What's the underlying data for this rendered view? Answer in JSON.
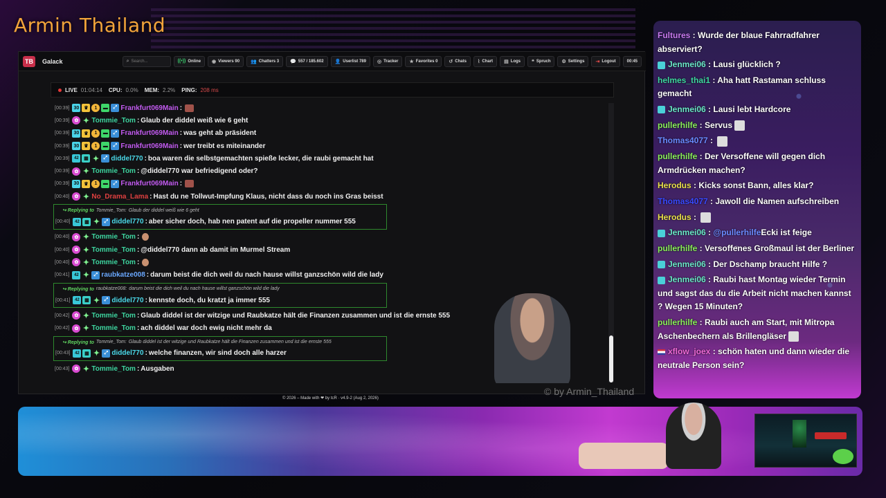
{
  "overlay": {
    "stream_title": "Armin Thailand",
    "watermark": "© by Armin_Thailand"
  },
  "app": {
    "name": "Galack",
    "logo_text": "TB",
    "toolbar": {
      "search_placeholder": "Search...",
      "online": "Online",
      "viewers": "Viewers 90",
      "chatters": "Chatters 3",
      "messages": "557 / 185.602",
      "userlist": "Userlist 789",
      "tracker": "Tracker",
      "favorites": "Favorites 0",
      "chats": "Chats",
      "chart": "Chart",
      "logs": "Logs",
      "spruch": "Spruch",
      "settings": "Settings",
      "logout": "Logout",
      "time": "00:45"
    },
    "status": {
      "live_label": "LIVE",
      "live_time": "01:04:14",
      "cpu_label": "CPU:",
      "cpu_value": "0.0%",
      "mem_label": "MEM:",
      "mem_value": "2.2%",
      "ping_label": "PING:",
      "ping_value": "208 ms"
    },
    "footer": "© 2026 – Made with ❤ by tcR · v4.9-2 (Aug 2, 2026)"
  },
  "colors": {
    "frankfurt": "#c25af0",
    "tommie": "#3ed6a0",
    "diddel": "#4ad8e8",
    "nodrama": "#e04040",
    "raubkatze": "#6aa8ff",
    "stream_title": "#f2a43a"
  },
  "chat": {
    "messages": [
      {
        "ts": "[00:39]",
        "user": "Frankfurt069Main",
        "color": "#c25af0",
        "text": "",
        "badges": [
          "sub",
          "crown",
          "gold",
          "green",
          "axe"
        ],
        "emote": true
      },
      {
        "ts": "[00:39]",
        "user": "Tommie_Tom",
        "color": "#3ed6a0",
        "text": "Glaub der diddel weiß wie 6 geht",
        "badges": [
          "pink",
          "spark"
        ]
      },
      {
        "ts": "[00:39]",
        "user": "Frankfurt069Main",
        "color": "#c25af0",
        "text": "was geht ab präsident",
        "badges": [
          "sub",
          "crown",
          "gold",
          "green",
          "axe"
        ]
      },
      {
        "ts": "[00:39]",
        "user": "Frankfurt069Main",
        "color": "#c25af0",
        "text": "wer treibt es miteinander",
        "badges": [
          "sub",
          "crown",
          "gold",
          "green",
          "axe"
        ]
      },
      {
        "ts": "[00:39]",
        "user": "diddel770",
        "color": "#4ad8e8",
        "text": "boa waren die selbstgemachten spieße lecker, die raubi gemacht hat",
        "badges": [
          "num",
          "grid",
          "spark",
          "axe"
        ]
      },
      {
        "ts": "[00:39]",
        "user": "Tommie_Tom",
        "color": "#3ed6a0",
        "text": "@diddel770 war befriedigend oder?",
        "badges": [
          "pink",
          "spark"
        ]
      },
      {
        "ts": "[00:39]",
        "user": "Frankfurt069Main",
        "color": "#c25af0",
        "text": "",
        "badges": [
          "sub",
          "crown",
          "gold",
          "green",
          "axe"
        ],
        "emote": true
      },
      {
        "ts": "[00:40]",
        "user": "No_Drama_Lama",
        "color": "#e04040",
        "text": "Hast du ne Tollwut-Impfung Klaus, nicht dass du noch ins Gras beisst",
        "badges": [
          "pink",
          "spark"
        ]
      }
    ],
    "reply1": {
      "replying_to": "Replying to",
      "target": "Tommie_Tom:",
      "quote": "Glaub der diddel weiß wie 6 geht",
      "ts": "[00:40]",
      "user": "diddel770",
      "text": "aber sicher doch, hab nen patent auf die propeller nummer 555"
    },
    "messages2": [
      {
        "ts": "[00:40]",
        "user": "Tommie_Tom",
        "color": "#3ed6a0",
        "text": "",
        "emote": "face"
      },
      {
        "ts": "[00:40]",
        "user": "Tommie_Tom",
        "color": "#3ed6a0",
        "text": "@diddel770 dann ab damit im Murmel Stream"
      },
      {
        "ts": "[00:40]",
        "user": "Tommie_Tom",
        "color": "#3ed6a0",
        "text": "",
        "emote": "face"
      },
      {
        "ts": "[00:41]",
        "user": "raubkatze008",
        "color": "#6aa8ff",
        "text": "darum beist die dich weil du nach hause willst ganzschön wild die lady"
      }
    ],
    "reply2": {
      "replying_to": "Replying to",
      "target": "raubkatze008:",
      "quote": "darum beist die dich weil du nach hause willst ganzschön wild die lady",
      "ts": "[00:41]",
      "user": "diddel770",
      "text": "kennste doch, du kratzt ja immer 555"
    },
    "messages3": [
      {
        "ts": "[00:42]",
        "user": "Tommie_Tom",
        "color": "#3ed6a0",
        "text": "Glaub diddel ist der witzige und Raubkatze hält die Finanzen zusammen und ist die ernste 555"
      },
      {
        "ts": "[00:42]",
        "user": "Tommie_Tom",
        "color": "#3ed6a0",
        "text": "ach diddel war doch ewig nicht mehr da"
      }
    ],
    "reply3": {
      "replying_to": "Replying to",
      "target": "Tommie_Tom:",
      "quote": "Glaub diddel ist der witzige und Raubkatze hält die Finanzen zusammen und ist die ernste 555",
      "ts": "[00:43]",
      "user": "diddel770",
      "text": "welche finanzen, wir sind doch alle harzer"
    },
    "last": {
      "ts": "[00:43]",
      "user": "Tommie_Tom",
      "text": "Ausgaben"
    }
  },
  "side_chat": {
    "messages": [
      {
        "user": "Fultures",
        "color": "#c87af0",
        "text": "Wurde der blaue Fahrradfahrer abserviert?"
      },
      {
        "user": "Jenmei06",
        "color": "#6ae8c8",
        "text": "Lausi glücklich ?"
      },
      {
        "user": "helmes_thai1",
        "color": "#3ed6a0",
        "text": "Aha hatt Rastaman schluss gemacht"
      },
      {
        "user": "Jenmei06",
        "color": "#6ae8c8",
        "text": "Lausi lebt Hardcore"
      },
      {
        "user": "pullerhilfe",
        "color": "#8aef5a",
        "text": "Servus"
      },
      {
        "user": "Thomas4077",
        "color": "#6a8aff",
        "text": ""
      },
      {
        "user": "pullerhilfe",
        "color": "#8aef5a",
        "text": "Der Versoffene will gegen dich Armdrücken machen?"
      },
      {
        "user": "Herodus",
        "color": "#e8e04a",
        "text": "Kicks sonst Bann, alles klar?"
      },
      {
        "user": "Thomas4077",
        "color": "#3a4aff",
        "text": "Jawoll die Namen aufschreiben"
      },
      {
        "user": "Herodus",
        "color": "#e8e04a",
        "text": ""
      },
      {
        "user": "Jenmei06",
        "color": "#6ae8c8",
        "text": "Ecki ist feige",
        "mention": "@pullerhilfe"
      },
      {
        "user": "pullerhilfe",
        "color": "#8aef5a",
        "text": "Versoffenes Großmaul ist der Berliner"
      },
      {
        "user": "Jenmei06",
        "color": "#6ae8c8",
        "text": "Der Dschamp braucht Hilfe ?"
      },
      {
        "user": "Jenmei06",
        "color": "#6ae8c8",
        "text": "Raubi hast Montag wieder Termin und sagst das du die Arbeit nicht machen kannst ? Wegen 15 Minuten?"
      },
      {
        "user": "pullerhilfe",
        "color": "#8aef5a",
        "text": "Raubi auch am Start, mit Mitropa Aschenbechern als Brillengläser"
      },
      {
        "user": "xflow_joex",
        "color": "#f06ad8",
        "text": "schön haten und dann wieder die neutrale Person sein?"
      }
    ]
  }
}
